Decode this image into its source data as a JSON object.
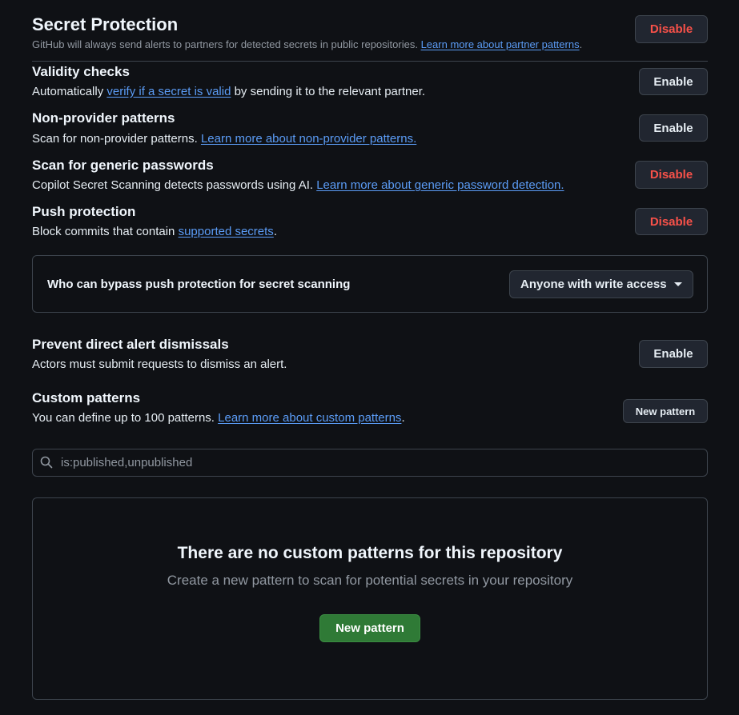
{
  "secret_protection": {
    "title": "Secret Protection",
    "description": "GitHub will always send alerts to partners for detected secrets in public repositories.",
    "link": "Learn more about partner patterns",
    "after_link": ".",
    "button": "Disable"
  },
  "validity": {
    "title": "Validity checks",
    "before_link": "Automatically",
    "link": "verify if a secret is valid",
    "after_link": "by sending it to the relevant partner.",
    "button": "Enable"
  },
  "non_provider": {
    "title": "Non-provider patterns",
    "before_link": "Scan for non-provider patterns.",
    "link": "Learn more about non-provider patterns.",
    "button": "Enable"
  },
  "generic_passwords": {
    "title": "Scan for generic passwords",
    "before_link": "Copilot Secret Scanning detects passwords using AI.",
    "link": "Learn more about generic password detection.",
    "button": "Disable"
  },
  "push_protection": {
    "title": "Push protection",
    "before_link": "Block commits that contain",
    "link": "supported secrets",
    "after_link": ".",
    "button": "Disable"
  },
  "bypass": {
    "label": "Who can bypass push protection for secret scanning",
    "selected": "Anyone with write access"
  },
  "dismissals": {
    "title": "Prevent direct alert dismissals",
    "description": "Actors must submit requests to dismiss an alert.",
    "button": "Enable"
  },
  "custom_patterns": {
    "title": "Custom patterns",
    "before_link": "You can define up to 100 patterns.",
    "link": "Learn more about custom patterns",
    "after_link": ".",
    "button": "New pattern"
  },
  "search": {
    "value": "is:published,unpublished"
  },
  "empty_state": {
    "title": "There are no custom patterns for this repository",
    "description": "Create a new pattern to scan for potential secrets in your repository",
    "button": "New pattern"
  },
  "colors": {
    "background": "#0f1115",
    "link": "#5b9cf6",
    "danger": "#f85149",
    "primary_button": "#2f7a36"
  }
}
